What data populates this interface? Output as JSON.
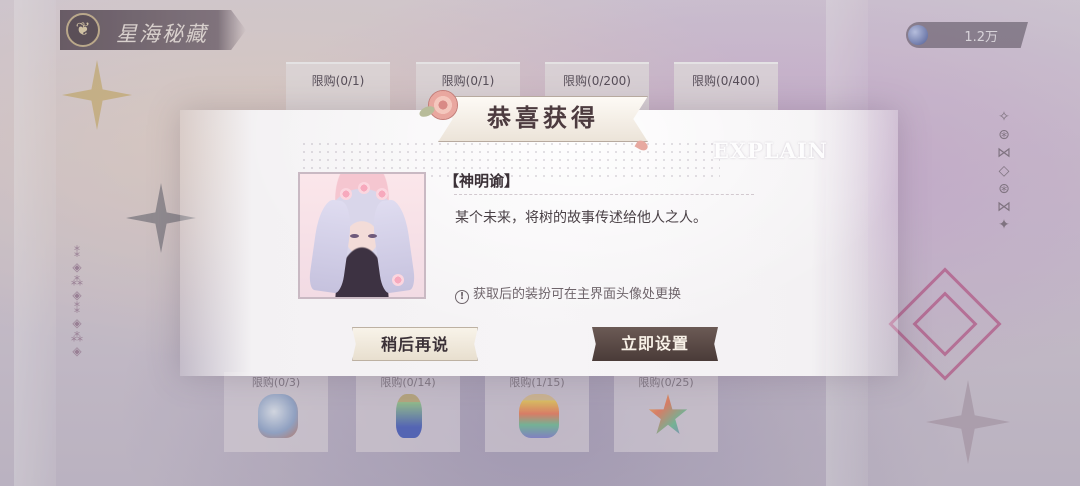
{
  "header": {
    "title": "星海秘藏",
    "emblem_icon": "butterfly-icon",
    "currency_icon": "coin-icon",
    "currency_amount": "1.2万"
  },
  "shop_cards": [
    {
      "limit": "限购(0/1)"
    },
    {
      "limit": "限购(0/1)"
    },
    {
      "limit": "限购(0/200)"
    },
    {
      "limit": "限购(0/400)"
    }
  ],
  "bottom_cards": [
    {
      "limit": "限购(0/3)",
      "item_icon": "gift-bag-icon"
    },
    {
      "limit": "限购(0/14)",
      "item_icon": "potion-bottle-icon"
    },
    {
      "limit": "限购(1/15)",
      "item_icon": "rainbow-jar-icon"
    },
    {
      "limit": "限购(0/25)",
      "item_icon": "rainbow-star-icon"
    }
  ],
  "dialog": {
    "banner_title": "恭喜获得",
    "watermark": "EXPLAIN",
    "item_name": "【神明谕】",
    "item_description": "某个未来，将树的故事传述给他人之人。",
    "note_icon": "!",
    "note": "获取后的装扮可在主界面头像处更换",
    "later_button": "稍后再说",
    "set_button": "立即设置"
  },
  "colors": {
    "dialog_bg": "#f6f4f6",
    "primary_button": "#4a3b38",
    "secondary_button": "#f8f3e9",
    "text": "#3b3137"
  }
}
